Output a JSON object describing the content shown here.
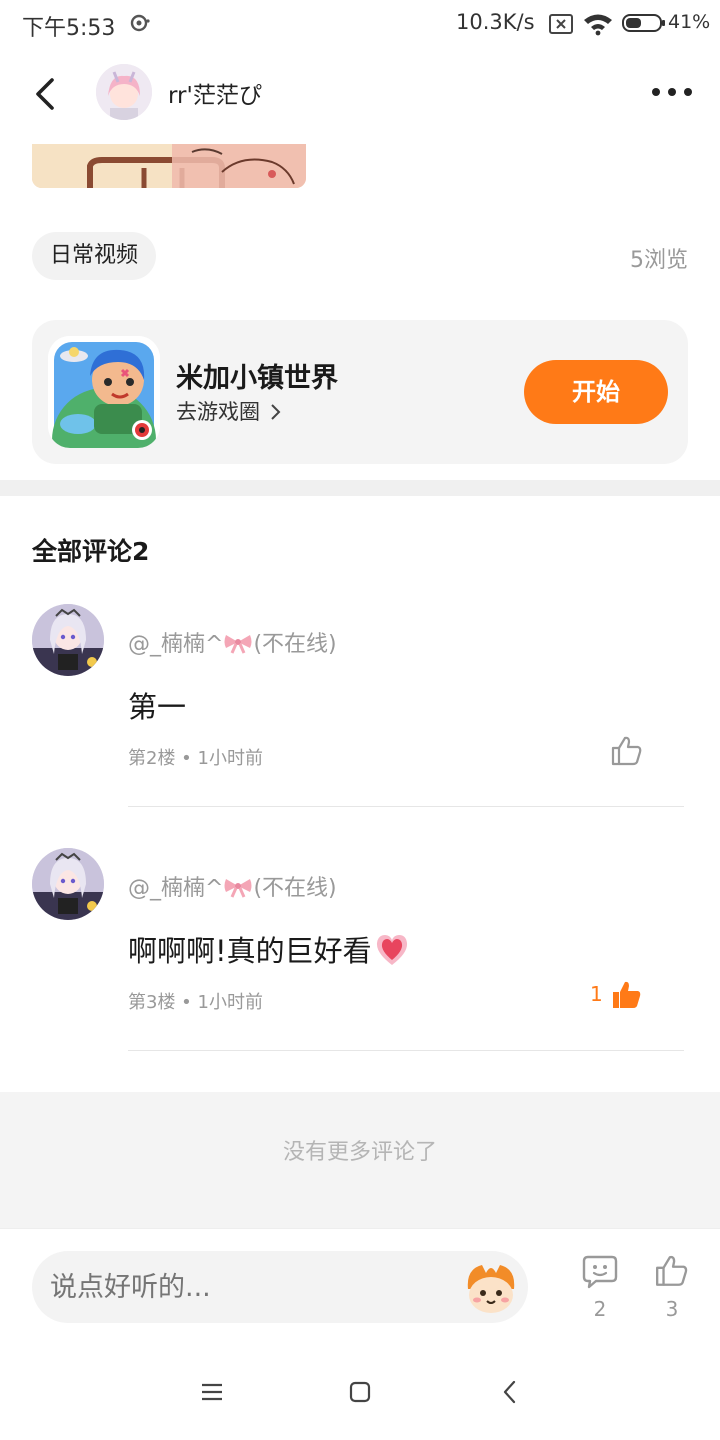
{
  "status_bar": {
    "time": "下午5:53",
    "speed": "10.3K/s",
    "battery": "41%"
  },
  "header": {
    "username": "rr'茫茫ぴ"
  },
  "post": {
    "tag": "日常视频",
    "views": "5浏览"
  },
  "game_card": {
    "title": "米加小镇世界",
    "link_label": "去游戏圈",
    "start_label": "开始",
    "accent_color": "#ff7a17"
  },
  "comments": {
    "title": "全部评论2",
    "items": [
      {
        "author": "@_楠楠^",
        "author_suffix": "(不在线)",
        "text": "第一",
        "meta": "第2楼 • 1小时前",
        "likes": "",
        "liked": false
      },
      {
        "author": "@_楠楠^",
        "author_suffix": "(不在线)",
        "text": "啊啊啊!真的巨好看",
        "meta": "第3楼 • 1小时前",
        "likes": "1",
        "liked": true
      }
    ],
    "no_more": "没有更多评论了"
  },
  "bottom_bar": {
    "input_placeholder": "说点好听的...",
    "comment_count": "2",
    "like_count": "3"
  },
  "icons": {
    "back": "back-arrow-icon",
    "more": "more-dots-icon",
    "like": "thumbs-up-icon",
    "comment": "comment-bubble-icon",
    "nav": [
      "menu-icon",
      "home-square-icon",
      "back-triangle-icon"
    ]
  }
}
